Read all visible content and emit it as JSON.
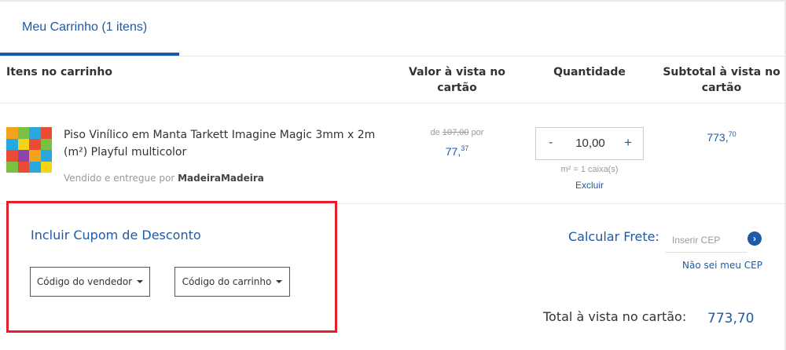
{
  "tab": {
    "label": "Meu Carrinho (1 itens)"
  },
  "table_headers": {
    "items": "Itens no carrinho",
    "price": "Valor à vista no cartão",
    "quantity": "Quantidade",
    "subtotal": "Subtotal à vista no cartão"
  },
  "product": {
    "name": "Piso Vinílico em Manta Tarkett Imagine Magic 3mm x 2m (m²) Playful multicolor",
    "seller_prefix": "Vendido e entregue por",
    "seller_name": "MadeiraMadeira",
    "old_price_prefix": "de",
    "old_price": "107,00",
    "old_price_suffix": "por",
    "price_int": "77,",
    "price_cents": "37",
    "quantity": "10,00",
    "qty_minus": "-",
    "qty_plus": "+",
    "unit_note": "m² = 1 caixa(s)",
    "remove_label": "Excluir",
    "subtotal_int": "773,",
    "subtotal_cents": "70"
  },
  "coupon": {
    "title": "Incluir Cupom de Desconto",
    "seller_code_label": "Código do vendedor",
    "cart_code_label": "Código do carrinho"
  },
  "shipping": {
    "label": "Calcular Frete:",
    "cep_placeholder": "Inserir CEP",
    "unknown_cep_link": "Não sei meu CEP"
  },
  "total": {
    "label": "Total à vista no cartão:",
    "value": "773,70"
  },
  "colors": {
    "accent": "#1d5aa7",
    "highlight_box": "#e41e2a"
  },
  "icons": {
    "go": "chevron-right-circle-icon",
    "dropdown": "caret-down-icon"
  }
}
